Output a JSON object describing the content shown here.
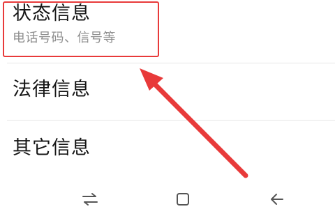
{
  "settings": {
    "items": [
      {
        "title": "状态信息",
        "subtitle": "电话号码、信号等"
      },
      {
        "title": "法律信息"
      },
      {
        "title": "其它信息"
      }
    ]
  },
  "annotation": {
    "highlight_color": "#e83a3a",
    "arrow_color": "#e83a3a"
  },
  "nav_bar": {
    "buttons": [
      {
        "icon": "recent-apps-icon"
      },
      {
        "icon": "home-icon"
      },
      {
        "icon": "back-icon"
      }
    ]
  }
}
